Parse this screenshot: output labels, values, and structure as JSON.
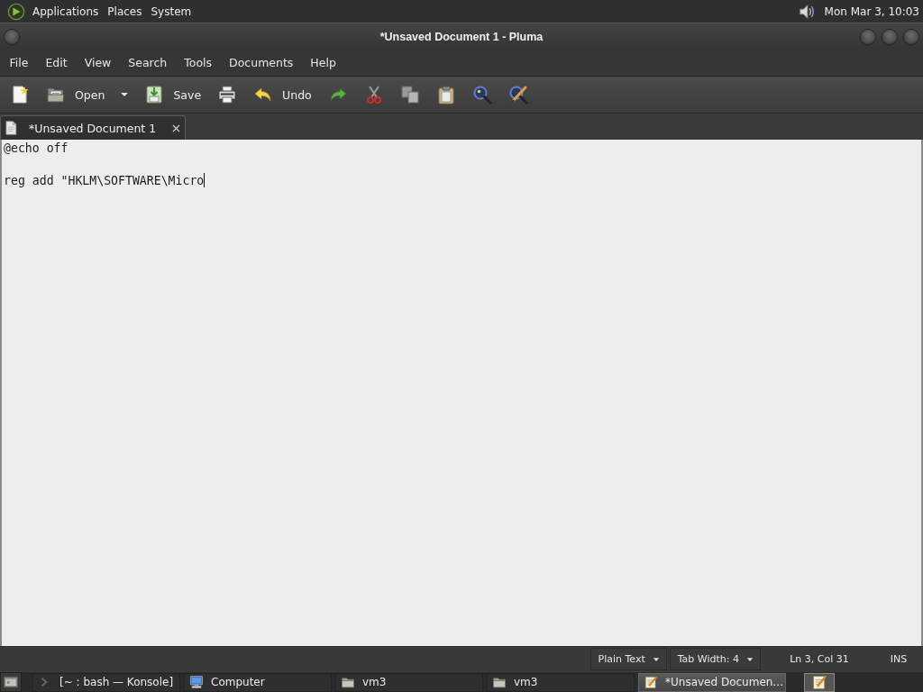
{
  "top_panel": {
    "menus": [
      "Applications",
      "Places",
      "System"
    ],
    "clock": "Mon Mar 3, 10:03"
  },
  "window": {
    "title": "*Unsaved Document 1 - Pluma"
  },
  "menubar": [
    "File",
    "Edit",
    "View",
    "Search",
    "Tools",
    "Documents",
    "Help"
  ],
  "toolbar": [
    {
      "kind": "new"
    },
    {
      "kind": "open",
      "label": "Open"
    },
    {
      "kind": "dropdown"
    },
    {
      "kind": "save",
      "label": "Save"
    },
    {
      "kind": "print"
    },
    {
      "kind": "undo",
      "label": "Undo"
    },
    {
      "kind": "redo"
    },
    {
      "kind": "cut"
    },
    {
      "kind": "copy"
    },
    {
      "kind": "paste"
    },
    {
      "kind": "find"
    },
    {
      "kind": "replace"
    }
  ],
  "tabs": [
    {
      "label": "*Unsaved Document 1",
      "selected": true
    }
  ],
  "editor": {
    "text": "@echo off\n\nreg add \"HKLM\\SOFTWARE\\Micro"
  },
  "status_bar": {
    "language": "Plain Text",
    "tab_width": "Tab Width: 4",
    "position": "Ln 3, Col 31",
    "mode": "INS"
  },
  "taskbar": [
    {
      "kind": "terminal",
      "label": "[~ : bash — Konsole]",
      "selected": false
    },
    {
      "kind": "computer",
      "label": "Computer",
      "selected": false
    },
    {
      "kind": "folder",
      "label": "vm3",
      "selected": false
    },
    {
      "kind": "folder",
      "label": "vm3",
      "selected": false
    },
    {
      "kind": "editor",
      "label": "*Unsaved Documen…",
      "selected": true
    }
  ]
}
